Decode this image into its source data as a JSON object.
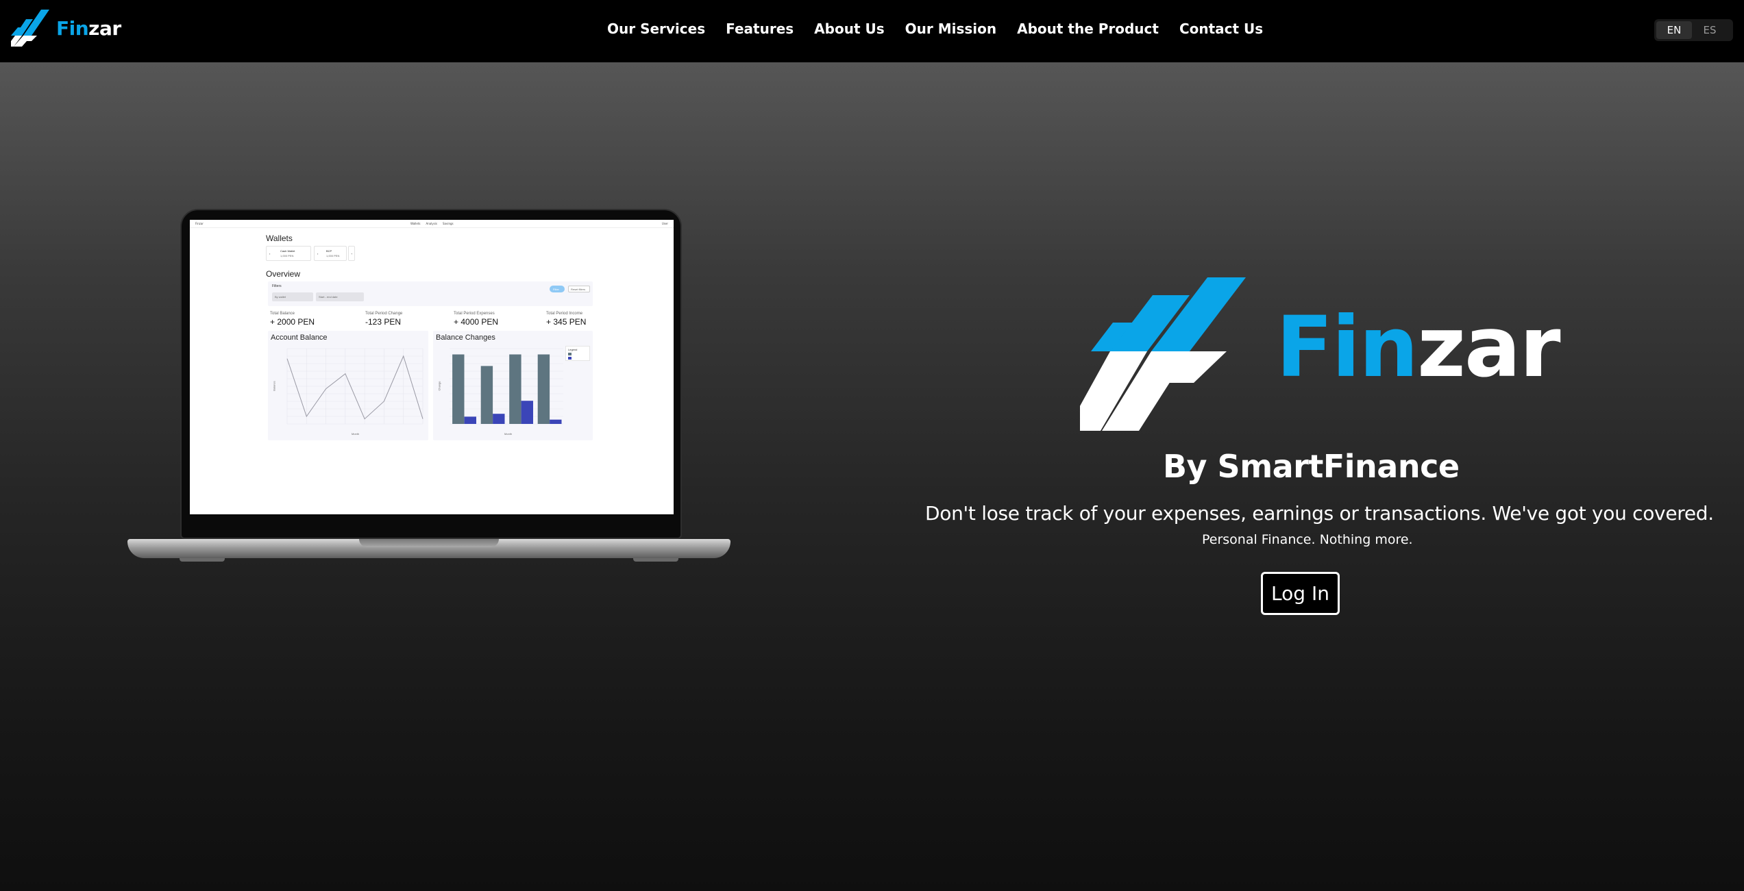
{
  "colors": {
    "accent": "#0aa5e8",
    "nav_bg": "#000000",
    "hero_top": "#565656",
    "hero_bottom": "#0f0f0f",
    "bar_gray": "#5e7580",
    "bar_blue": "#3b45b8"
  },
  "navbar": {
    "brand": {
      "icon": "finzar-logo-icon",
      "name_part1": "Fin",
      "name_part2": "zar"
    },
    "links": [
      "Our Services",
      "Features",
      "About Us",
      "Our Mission",
      "About the Product",
      "Contact Us"
    ],
    "languages": [
      "EN",
      "ES"
    ],
    "active_language": "EN"
  },
  "hero": {
    "logo": {
      "name_part1": "Fin",
      "name_part2": "zar"
    },
    "byline": "By SmartFinance",
    "tagline": "Don't lose track of your expenses, earnings or transactions. We've got you covered.",
    "subtagline": "Personal Finance. Nothing more.",
    "login_button": "Log In"
  },
  "laptop_screen": {
    "brand": "Finzar",
    "nav": [
      "Wallets",
      "Analysis",
      "Savings"
    ],
    "user": "User",
    "wallets_title": "Wallets",
    "wallets": [
      {
        "name": "Cash Wallet",
        "amount": "1,000 PEN"
      },
      {
        "name": "BCP",
        "amount": "1,000 PEN"
      }
    ],
    "overview_title": "Overview",
    "filters_label": "Filters",
    "filter_select": "By wallet",
    "filter_dates": "Start - end date",
    "filter_apply": "Filter",
    "filter_reset": "Reset filters",
    "stats": [
      {
        "label": "Total Balance",
        "value": "+ 2000 PEN"
      },
      {
        "label": "Total Period Change",
        "value": "-123 PEN"
      },
      {
        "label": "Total Period Expenses",
        "value": "+ 4000 PEN"
      },
      {
        "label": "Total Period Income",
        "value": "+ 345 PEN"
      }
    ],
    "legend_title": "Legend",
    "account_chart": {
      "type": "line",
      "title": "Account Balance",
      "xlabel": "Month",
      "ylabel": "Balance",
      "y": [
        2600,
        300,
        1400,
        2000,
        200,
        900,
        2700,
        200
      ]
    },
    "balance_chart": {
      "type": "bar",
      "title": "Balance Changes",
      "xlabel": "Month",
      "ylabel": "Change",
      "series": [
        {
          "values": [
            2400,
            2000,
            2400,
            2400
          ]
        },
        {
          "values": [
            250,
            350,
            800,
            150
          ]
        }
      ]
    }
  }
}
